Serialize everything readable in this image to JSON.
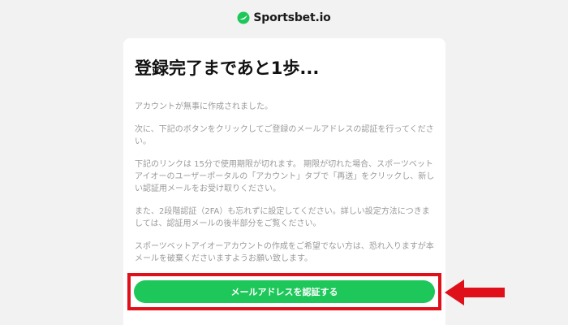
{
  "header": {
    "brand_name": "Sportsbet.io",
    "brand_icon": "sportsbet-logo-icon"
  },
  "card": {
    "heading": "登録完了まであと1歩...",
    "paragraphs": [
      "アカウントが無事に作成されました。",
      "次に、下記のボタンをクリックしてご登録のメールアドレスの認証を行ってください。",
      "下記のリンクは 15分で使用期限が切れます。 期限が切れた場合、スポーツベットアイオーのユーザーポータルの「アカウント」タブで「再送」をクリックし、新しい認証用メールをお受け取りください。",
      "また、2段階認証（2FA）も忘れずに設定してください。詳しい設定方法につきましては、認証用メールの後半部分をご覧ください。",
      "スポーツベットアイオーアカウントの作成をご希望でない方は、恐れ入りますが本メールを破棄くださいますようお願い致します。"
    ],
    "verify_button_label": "メールアドレスを認証する"
  },
  "annotation": {
    "highlight_color": "#e0101a",
    "arrow_icon": "left-arrow-icon"
  },
  "colors": {
    "accent": "#1ec75a",
    "background": "#f2f2f2"
  }
}
